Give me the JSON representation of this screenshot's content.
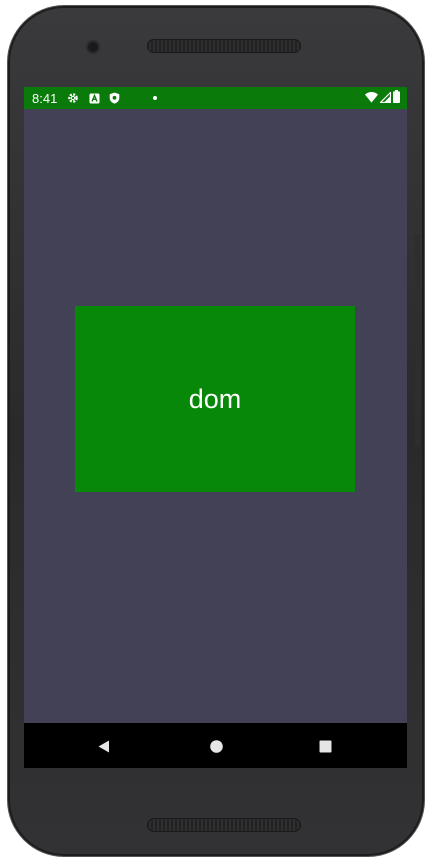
{
  "status_bar": {
    "time": "8:41",
    "left_icons": [
      "gear-icon",
      "a-box-icon",
      "shield-icon",
      "notification-dot-icon"
    ],
    "right_icons": [
      "wifi-icon",
      "signal-icon",
      "battery-icon"
    ],
    "background_color": "#0a7a0a"
  },
  "main": {
    "background_color": "#434155",
    "card": {
      "label": "dom",
      "background_color": "#088808"
    }
  },
  "nav_bar": {
    "buttons": [
      "back-button",
      "home-button",
      "recents-button"
    ]
  }
}
